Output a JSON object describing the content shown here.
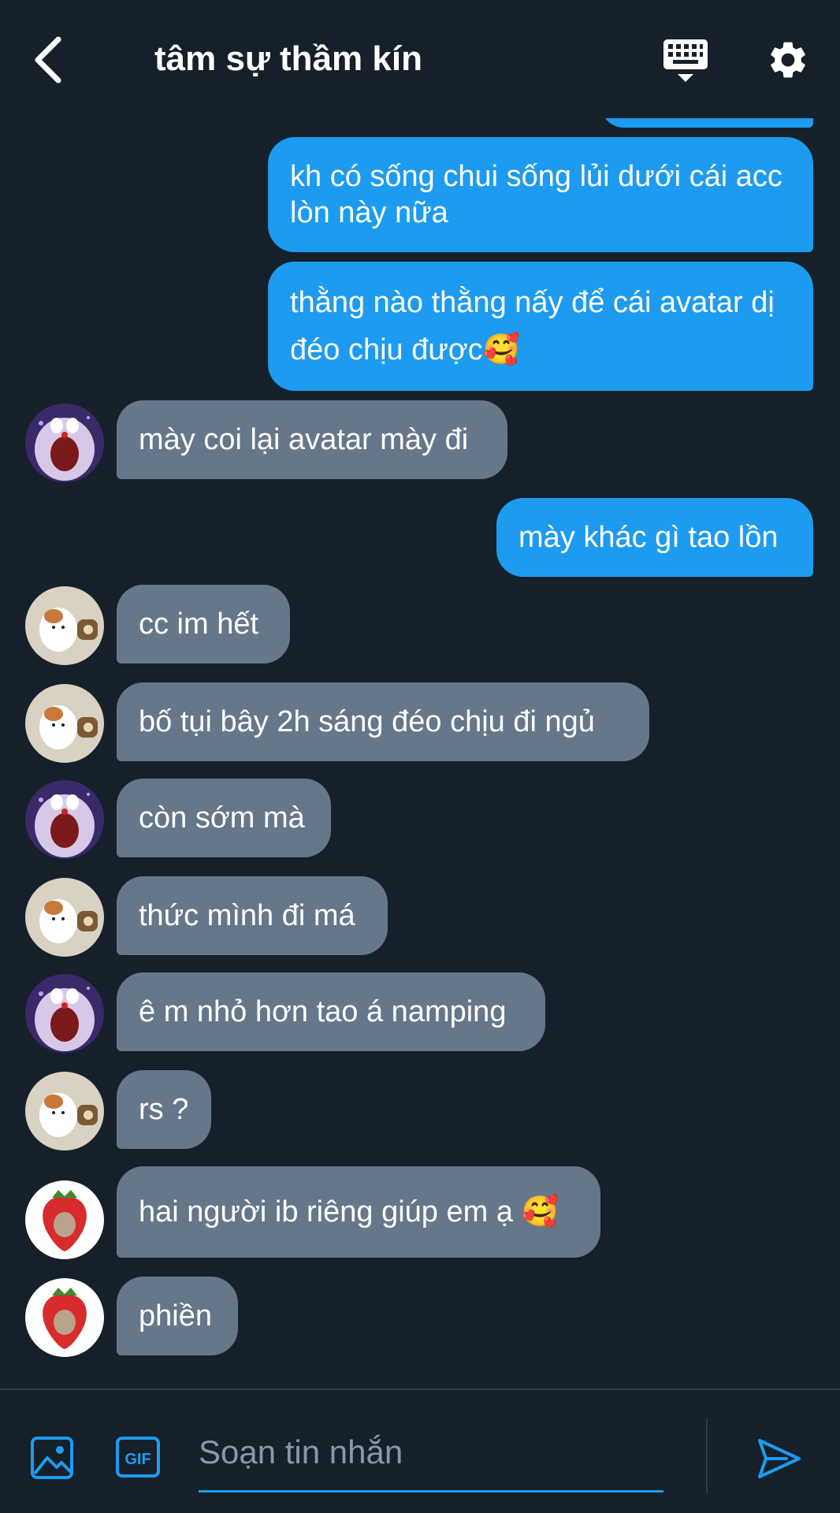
{
  "header": {
    "title": "tâm sự thầm kín",
    "icons": {
      "back": "chevron-left-icon",
      "keyboard": "keyboard-icon",
      "settings": "gear-icon"
    }
  },
  "messages": [
    {
      "from": "me",
      "text": "kh có sống chui sống lủi dưới cái acc lòn này nữa"
    },
    {
      "from": "me",
      "text": "thằng nào thằng nấy để cái avatar dị đéo chịu được🥰"
    },
    {
      "from": "doraemon",
      "text": "mày coi lại avatar mày đi"
    },
    {
      "from": "me",
      "text": "mày khác gì tao lồn"
    },
    {
      "from": "hamster",
      "text": "cc im hết"
    },
    {
      "from": "hamster",
      "text": "bố tụi bây 2h sáng đéo chịu đi ngủ"
    },
    {
      "from": "doraemon",
      "text": "còn sớm mà"
    },
    {
      "from": "hamster",
      "text": "thức mình đi má"
    },
    {
      "from": "doraemon",
      "text": "ê m nhỏ hơn tao á namping"
    },
    {
      "from": "hamster",
      "text": "rs ?"
    },
    {
      "from": "strawberry",
      "text": "hai người ib riêng giúp em ạ 🥰"
    },
    {
      "from": "strawberry",
      "text": "phiền"
    }
  ],
  "composer": {
    "placeholder": "Soạn tin nhắn",
    "gif_label": "GIF",
    "icons": {
      "image": "image-icon",
      "gif": "gif-icon",
      "send": "send-icon"
    }
  },
  "colors": {
    "background": "#15202b",
    "outgoing_bubble": "#1d9bf0",
    "incoming_bubble": "#66778a",
    "accent": "#1d9bf0"
  }
}
